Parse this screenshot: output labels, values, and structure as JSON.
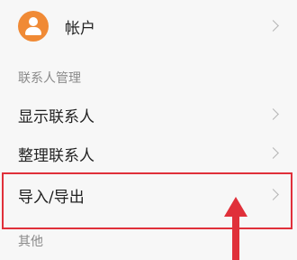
{
  "account": {
    "label": "帐户",
    "icon": "person-icon",
    "accent": "#f08a35"
  },
  "sections": {
    "contacts_management": {
      "title": "联系人管理",
      "items": [
        {
          "label": "显示联系人"
        },
        {
          "label": "整理联系人"
        },
        {
          "label": "导入/导出"
        }
      ]
    },
    "other": {
      "title": "其他"
    }
  },
  "annotation": {
    "color": "#e0303a"
  }
}
